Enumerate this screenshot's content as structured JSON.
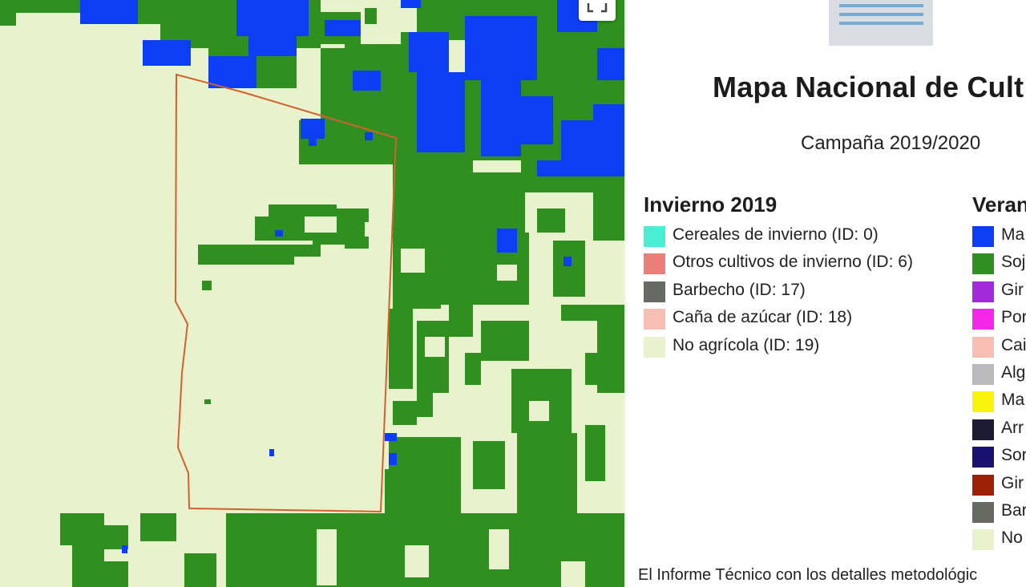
{
  "map": {
    "colors": {
      "background": "#e8f3cd",
      "soja": "#2f8f1f",
      "maiz": "#0b3ef5",
      "boundary": "#d5602f"
    },
    "fullscreen_icon": "fullscreen-icon"
  },
  "header": {
    "title": "Mapa Nacional de Cult",
    "subtitle": "Campaña 2019/2020"
  },
  "legend_invierno": {
    "heading": "Invierno 2019",
    "items": [
      {
        "label": "Cereales de invierno (ID: 0)",
        "color": "#4ceed3"
      },
      {
        "label": "Otros cultivos de invierno (ID: 6)",
        "color": "#ea7f7a"
      },
      {
        "label": "Barbecho (ID: 17)",
        "color": "#676a63"
      },
      {
        "label": "Caña de azúcar (ID: 18)",
        "color": "#f7bfb3"
      },
      {
        "label": "No agrícola (ID: 19)",
        "color": "#e8f3cd"
      }
    ]
  },
  "legend_verano": {
    "heading": "Veran",
    "items": [
      {
        "label": "Ma",
        "color": "#0b3ef5"
      },
      {
        "label": "Soj",
        "color": "#2f8f1f"
      },
      {
        "label": "Gir",
        "color": "#a42bdc"
      },
      {
        "label": "Por",
        "color": "#f327e5"
      },
      {
        "label": "Cai",
        "color": "#f7bfb3"
      },
      {
        "label": "Alg",
        "color": "#b9b9bb"
      },
      {
        "label": "Ma",
        "color": "#f8f30c"
      },
      {
        "label": "Arr",
        "color": "#1d1c34"
      },
      {
        "label": "Sor",
        "color": "#1a1170"
      },
      {
        "label": "Gir",
        "color": "#9b2006"
      },
      {
        "label": "Bar",
        "color": "#676a63"
      },
      {
        "label": "No",
        "color": "#e8f3cd"
      }
    ]
  },
  "footer": {
    "text": "El Informe Técnico con los detalles metodológic"
  }
}
